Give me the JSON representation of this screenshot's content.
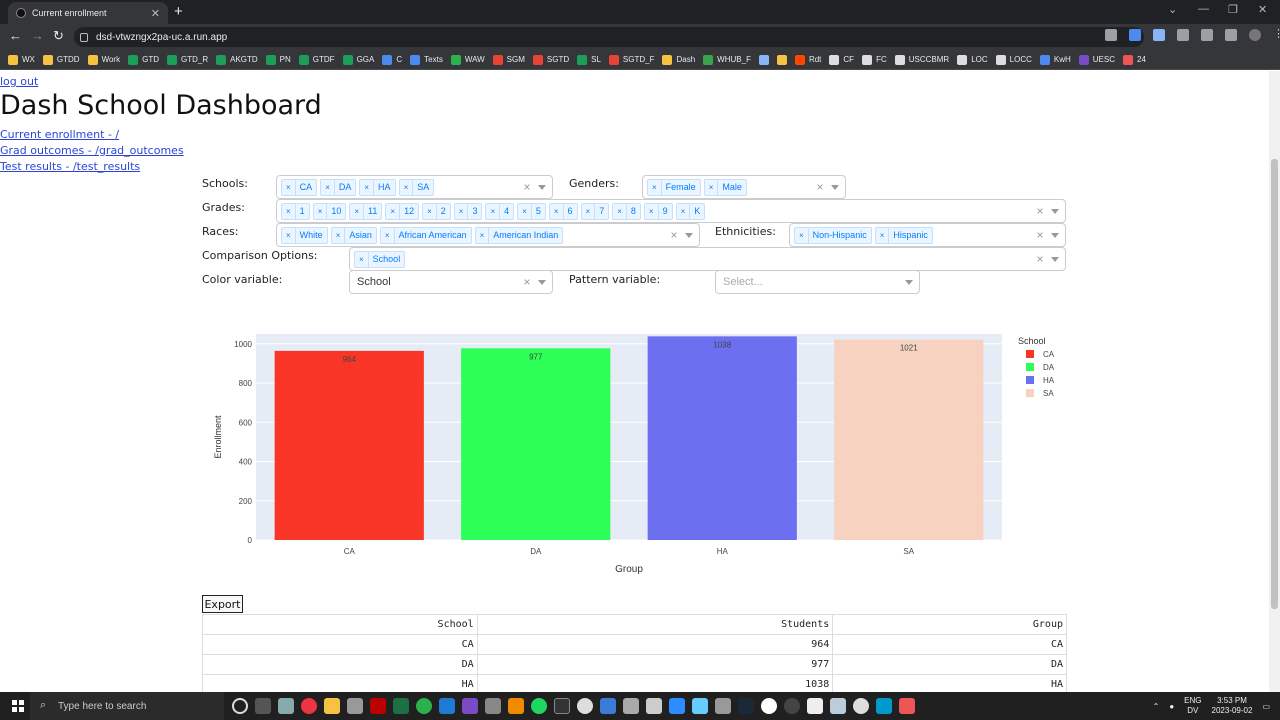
{
  "browser": {
    "tab_title": "Current enrollment",
    "url": "dsd-vtwzngx2pa-uc.a.run.app",
    "bookmarks": [
      "WX",
      "GTDD",
      "Work",
      "GTD",
      "GTD_R",
      "AKGTD",
      "PN",
      "GTDF",
      "GGA",
      "C",
      "Texts",
      "WAW",
      "SGM",
      "SGTD",
      "SL",
      "SGTD_F",
      "Dash",
      "WHUB_F",
      "",
      "",
      "Rdt",
      "CF",
      "FC",
      "USCCBMR",
      "LOC",
      "LOCC",
      "KwH",
      "UESC",
      "24"
    ]
  },
  "nav": {
    "logout": "log out",
    "title": "Dash School Dashboard",
    "links": [
      "Current enrollment - /",
      "Grad outcomes - /grad_outcomes",
      "Test results - /test_results"
    ]
  },
  "filters": {
    "schools_label": "Schools:",
    "schools": [
      "CA",
      "DA",
      "HA",
      "SA"
    ],
    "genders_label": "Genders:",
    "genders": [
      "Female",
      "Male"
    ],
    "grades_label": "Grades:",
    "grades": [
      "1",
      "10",
      "11",
      "12",
      "2",
      "3",
      "4",
      "5",
      "6",
      "7",
      "8",
      "9",
      "K"
    ],
    "races_label": "Races:",
    "races": [
      "White",
      "Asian",
      "African American",
      "American Indian"
    ],
    "ethnicities_label": "Ethnicities:",
    "ethnicities": [
      "Non-Hispanic",
      "Hispanic"
    ],
    "comparison_label": "Comparison Options:",
    "comparison": [
      "School"
    ],
    "color_label": "Color variable:",
    "color_value": "School",
    "pattern_label": "Pattern variable:",
    "pattern_placeholder": "Select..."
  },
  "chart_data": {
    "type": "bar",
    "categories": [
      "CA",
      "DA",
      "HA",
      "SA"
    ],
    "values": [
      964,
      977,
      1038,
      1021
    ],
    "colors": [
      "#f83526",
      "#2cff55",
      "#6b6ff0",
      "#f8d2c0"
    ],
    "xlabel": "Group",
    "ylabel": "Enrollment",
    "ylim": [
      0,
      1050
    ],
    "yticks": [
      0,
      200,
      400,
      600,
      800,
      1000
    ],
    "legend_title": "School",
    "legend_position": "top-right",
    "plot_bg": "#e5ecf6",
    "grid": true
  },
  "export_label": "Export",
  "table": {
    "headers": [
      "School",
      "Students",
      "Group"
    ],
    "rows": [
      [
        "CA",
        "964",
        "CA"
      ],
      [
        "DA",
        "977",
        "DA"
      ],
      [
        "HA",
        "1038",
        "HA"
      ]
    ]
  },
  "taskbar": {
    "search_placeholder": "Type here to search",
    "lang1": "ENG",
    "lang2": "DV",
    "time": "3:53 PM",
    "date": "2023-09-02"
  }
}
